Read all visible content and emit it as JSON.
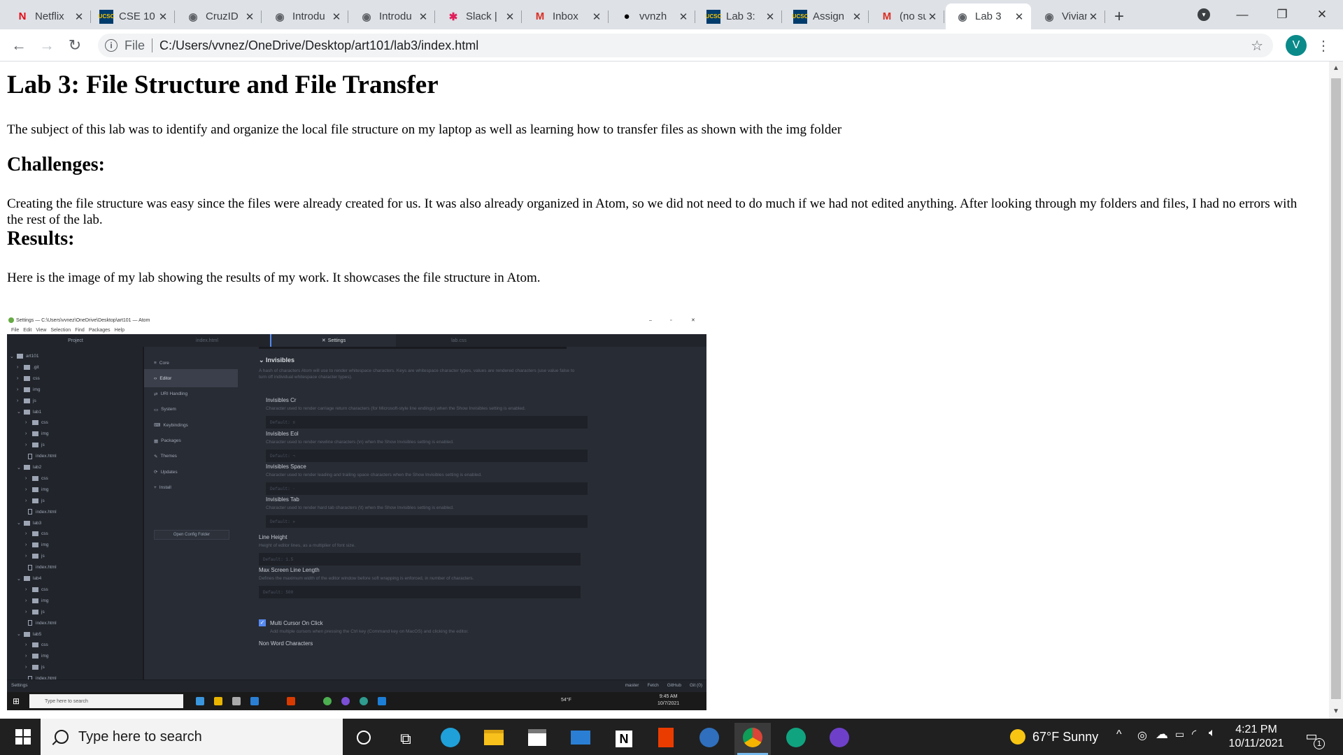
{
  "browser": {
    "tabs": [
      {
        "title": "Netflix",
        "icon": "netflix-icon",
        "active": false
      },
      {
        "title": "CSE 10",
        "icon": "ucsc-icon",
        "active": false
      },
      {
        "title": "CruzID",
        "icon": "globe-icon",
        "active": false
      },
      {
        "title": "Introdu",
        "icon": "globe-icon",
        "active": false
      },
      {
        "title": "Introdu",
        "icon": "globe-icon",
        "active": false
      },
      {
        "title": "Slack |",
        "icon": "slack-icon",
        "active": false
      },
      {
        "title": "Inbox",
        "icon": "gmail-icon",
        "active": false
      },
      {
        "title": "vvnzh",
        "icon": "github-icon",
        "active": false
      },
      {
        "title": "Lab 3:",
        "icon": "ucsc-icon",
        "active": false
      },
      {
        "title": "Assign",
        "icon": "ucsc-icon",
        "active": false
      },
      {
        "title": "(no su",
        "icon": "gmail-icon",
        "active": false
      },
      {
        "title": "Lab 3",
        "icon": "globe-icon",
        "active": true
      },
      {
        "title": "Vivian",
        "icon": "globe-icon",
        "active": false
      }
    ],
    "url_scheme": "File",
    "url": "C:/Users/vvnez/OneDrive/Desktop/art101/lab3/index.html",
    "profile_initial": "V",
    "accent": "#0b8a8a"
  },
  "page": {
    "title": "Lab 3: File Structure and File Transfer",
    "intro": "The subject of this lab was to identify and organize the local file structure on my laptop as well as learning how to transfer files as shown with the img folder",
    "challenges_heading": "Challenges:",
    "challenges_text": "Creating the file structure was easy since the files were already created for us. It was also already organized in Atom, so we did not need to do much if we had not edited anything. After looking through my folders and files, I had no errors with the rest of the lab.",
    "results_heading": "Results:",
    "results_text": "Here is the image of my lab showing the results of my work. It showcases the file structure in Atom."
  },
  "atom": {
    "window_title": "Settings — C:\\Users\\vvnez\\OneDrive\\Desktop\\art101 — Atom",
    "menu": [
      "File",
      "Edit",
      "View",
      "Selection",
      "Find",
      "Packages",
      "Help"
    ],
    "tabs": [
      "Project",
      "index.html",
      "Settings",
      "lab.css"
    ],
    "tree": [
      {
        "label": "art101",
        "kind": "root"
      },
      {
        "label": ".git",
        "kind": "folder"
      },
      {
        "label": "css",
        "kind": "folder"
      },
      {
        "label": "img",
        "kind": "folder"
      },
      {
        "label": "js",
        "kind": "folder"
      },
      {
        "label": "lab1",
        "kind": "open"
      },
      {
        "label": "css",
        "kind": "sub"
      },
      {
        "label": "img",
        "kind": "sub"
      },
      {
        "label": "js",
        "kind": "sub"
      },
      {
        "label": "index.html",
        "kind": "file"
      },
      {
        "label": "lab2",
        "kind": "open"
      },
      {
        "label": "css",
        "kind": "sub"
      },
      {
        "label": "img",
        "kind": "sub"
      },
      {
        "label": "js",
        "kind": "sub"
      },
      {
        "label": "index.html",
        "kind": "file"
      },
      {
        "label": "lab3",
        "kind": "open"
      },
      {
        "label": "css",
        "kind": "sub"
      },
      {
        "label": "img",
        "kind": "sub"
      },
      {
        "label": "js",
        "kind": "sub"
      },
      {
        "label": "index.html",
        "kind": "file"
      },
      {
        "label": "lab4",
        "kind": "open"
      },
      {
        "label": "css",
        "kind": "sub"
      },
      {
        "label": "img",
        "kind": "sub"
      },
      {
        "label": "js",
        "kind": "sub"
      },
      {
        "label": "index.html",
        "kind": "file"
      },
      {
        "label": "lab5",
        "kind": "open"
      },
      {
        "label": "css",
        "kind": "sub"
      },
      {
        "label": "img",
        "kind": "sub"
      },
      {
        "label": "js",
        "kind": "sub"
      },
      {
        "label": "index.html",
        "kind": "file"
      }
    ],
    "settings_nav": [
      "Core",
      "Editor",
      "URI Handling",
      "System",
      "Keybindings",
      "Packages",
      "Themes",
      "Updates",
      "Install"
    ],
    "selected_nav": "Editor",
    "open_config": "Open Config Folder",
    "section": "Invisibles",
    "section_desc": "A hash of characters Atom will use to render whitespace characters. Keys are whitespace character types, values are rendered characters (use value false to turn off individual whitespace character types).",
    "settings": [
      {
        "name": "Invisibles Cr",
        "desc": "Character used to render carriage return characters (for Microsoft-style line endings) when the Show Invisibles setting is enabled.",
        "default": "Default: ¤"
      },
      {
        "name": "Invisibles Eol",
        "desc": "Character used to render newline characters (\\n) when the Show Invisibles setting is enabled.",
        "default": "Default: ¬"
      },
      {
        "name": "Invisibles Space",
        "desc": "Character used to render leading and trailing space characters when the Show Invisibles setting is enabled.",
        "default": "Default: ·"
      },
      {
        "name": "Invisibles Tab",
        "desc": "Character used to render hard tab characters (\\t) when the Show Invisibles setting is enabled.",
        "default": "Default: »"
      },
      {
        "name": "Line Height",
        "desc": "Height of editor lines, as a multiplier of font size.",
        "default": "Default: 1.5"
      },
      {
        "name": "Max Screen Line Length",
        "desc": "Defines the maximum width of the editor window before soft wrapping is enforced, in number of characters.",
        "default": "Default: 500"
      }
    ],
    "checkbox_label": "Multi Cursor On Click",
    "checkbox_desc": "Add multiple cursors when pressing the Ctrl key (Command key on MacOS) and clicking the editor.",
    "next_setting": "Non Word Characters",
    "status_left": "Settings",
    "status_right": [
      "master",
      "Fetch",
      "GitHub",
      "Git (0)"
    ],
    "taskbar_search": "Type here to search",
    "taskbar_weather": "54°F",
    "taskbar_time": "9:45 AM",
    "taskbar_date": "10/7/2021"
  },
  "taskbar": {
    "search_placeholder": "Type here to search",
    "weather": "67°F  Sunny",
    "time": "4:21 PM",
    "date": "10/11/2021",
    "notifications": "1",
    "apps": [
      "cortana-icon",
      "task-view-icon",
      "edge-icon",
      "file-explorer-icon",
      "store-icon",
      "mail-icon",
      "notion-icon",
      "office-icon",
      "vpn-icon",
      "chrome-icon",
      "chatgpt-icon",
      "github-desktop-icon"
    ]
  }
}
